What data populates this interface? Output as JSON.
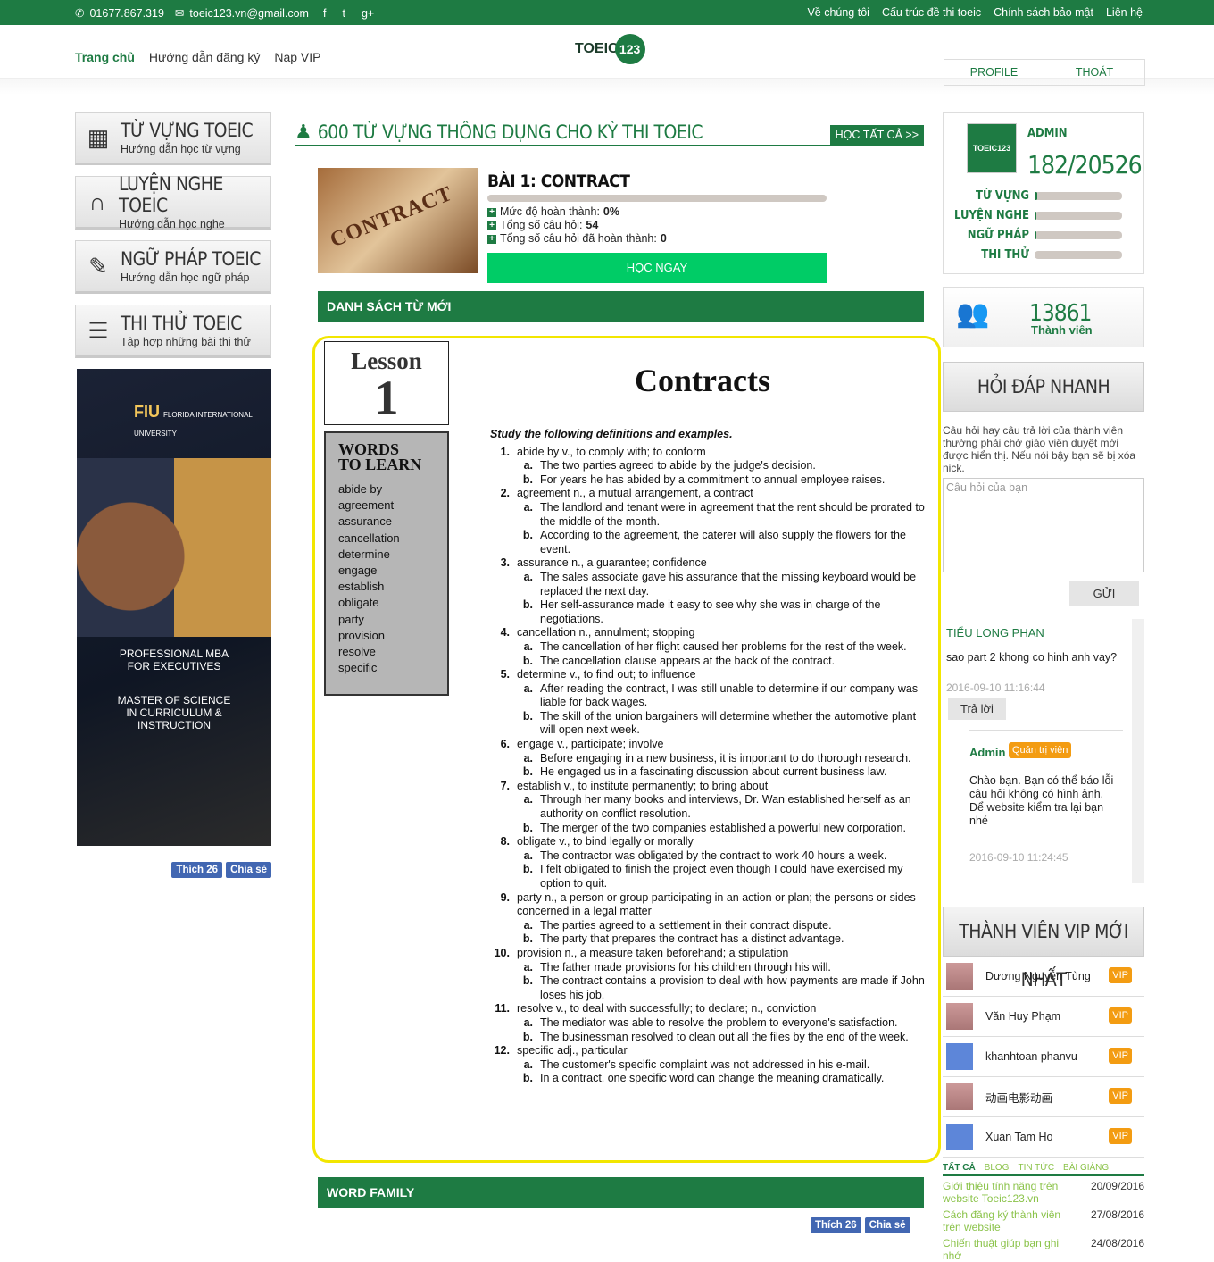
{
  "topbar": {
    "phone": "01677.867.319",
    "email": "toeic123.vn@gmail.com",
    "social": [
      "f",
      "t",
      "g+"
    ],
    "links": [
      "Về chúng tôi",
      "Cấu trúc đề thi toeic",
      "Chính sách bảo mật",
      "Liên hệ"
    ]
  },
  "nav": {
    "menu": [
      "Trang chủ",
      "Hướng dẫn đăng ký",
      "Nạp VIP"
    ],
    "logo_text": "TOEIC",
    "logo_num": "123",
    "profile": "PROFILE",
    "logout": "THOÁT"
  },
  "left": {
    "buttons": [
      {
        "icon": "abc-blocks-icon",
        "glyph": "▦",
        "title": "TỪ VỰNG TOEIC",
        "sub": "Hướng dẫn học từ vựng"
      },
      {
        "icon": "headphones-icon",
        "glyph": "🎧",
        "title": "LUYỆN NGHE TOEIC",
        "sub": "Hướng dẫn học nghe"
      },
      {
        "icon": "pencil-icon",
        "glyph": "✎",
        "title": "NGỮ PHÁP TOEIC",
        "sub": "Hướng dẫn học ngữ pháp"
      },
      {
        "icon": "test-document-icon",
        "glyph": "☰",
        "title": "THI THỬ TOEIC",
        "sub": "Tập hợp những bài thi thử"
      }
    ],
    "ad": {
      "logo": "FIU",
      "logo_sub": "FLORIDA INTERNATIONAL UNIVERSITY",
      "lines": [
        "PROFESSIONAL MBA",
        "FOR EXECUTIVES",
        "MASTER OF SCIENCE",
        "IN CURRICULUM &",
        "INSTRUCTION"
      ]
    },
    "like": "Thích 26",
    "share": "Chia sẻ"
  },
  "center": {
    "title": "600 TỪ VỰNG THÔNG DỤNG CHO KỲ THI TOEIC",
    "learn_all": "HỌC TẤT CẢ >>",
    "lesson": {
      "img_text": "CONTRACT",
      "name": "BÀI 1: CONTRACT",
      "progress": 0,
      "r1_label": "Mức độ hoàn thành:",
      "r1_val": "0%",
      "r2_label": "Tổng số câu hỏi:",
      "r2_val": "54",
      "r3_label": "Tổng số câu hỏi đã hoàn thành:",
      "r3_val": "0",
      "go": "HỌC NGAY"
    },
    "sec1": "DANH SÁCH TỪ MỚI",
    "sec2": "WORD FAMILY",
    "doc": {
      "lesson_label": "Lesson",
      "lesson_num": "1",
      "title": "Contracts",
      "wtl_title1": "WORDS",
      "wtl_title2": "TO LEARN",
      "words": [
        "abide by",
        "agreement",
        "assurance",
        "cancellation",
        "determine",
        "engage",
        "establish",
        "obligate",
        "party",
        "provision",
        "resolve",
        "specific"
      ],
      "intro": "Study the following definitions and examples.",
      "items": [
        {
          "n": "1.",
          "head": "abide by v., to comply with; to conform",
          "a": "The two parties agreed to abide by the judge's decision.",
          "b": "For years he has abided by a commitment to annual employee raises."
        },
        {
          "n": "2.",
          "head": "agreement n., a mutual arrangement, a contract",
          "a": "The landlord and tenant were in agreement that the rent should be prorated to the middle of the month.",
          "b": "According to the agreement, the caterer will also supply the flowers for the event."
        },
        {
          "n": "3.",
          "head": "assurance n., a guarantee; confidence",
          "a": "The sales associate gave his assurance that the missing keyboard would be replaced the next day.",
          "b": "Her self-assurance made it easy to see why she was in charge of the negotiations."
        },
        {
          "n": "4.",
          "head": "cancellation n., annulment; stopping",
          "a": "The cancellation of her flight caused her problems for the rest of the week.",
          "b": "The cancellation clause appears at the back of the contract."
        },
        {
          "n": "5.",
          "head": "determine v., to find out; to influence",
          "a": "After reading the contract, I was still unable to determine if our company was liable for back wages.",
          "b": "The skill of the union bargainers will determine whether the automotive plant will open next week."
        },
        {
          "n": "6.",
          "head": "engage v., participate; involve",
          "a": "Before engaging in a new business, it is important to do thorough research.",
          "b": "He engaged us in a fascinating discussion about current business law."
        },
        {
          "n": "7.",
          "head": "establish v., to institute permanently; to bring about",
          "a": "Through her many books and interviews, Dr. Wan established herself as an authority on conflict resolution.",
          "b": "The merger of the two companies established a powerful new corporation."
        },
        {
          "n": "8.",
          "head": "obligate v., to bind legally or morally",
          "a": "The contractor was obligated by the contract to work 40 hours a week.",
          "b": "I felt obligated to finish the project even though I could have exercised my option to quit."
        },
        {
          "n": "9.",
          "head": "party n., a person or group participating in an action or plan; the persons or sides concerned in a legal matter",
          "a": "The parties agreed to a settlement in their contract dispute.",
          "b": "The party that prepares the contract has a distinct advantage."
        },
        {
          "n": "10.",
          "head": "provision n., a measure taken beforehand; a stipulation",
          "a": "The father made provisions for his children through his will.",
          "b": "The contract contains a provision to deal with how payments are made if John loses his job."
        },
        {
          "n": "11.",
          "head": "resolve v., to deal with successfully; to declare; n., conviction",
          "a": "The mediator was able to resolve the problem to everyone's satisfaction.",
          "b": "The businessman resolved to clean out all the files by the end of the week."
        },
        {
          "n": "12.",
          "head": "specific adj., particular",
          "a": "The customer's specific complaint was not addressed in his e-mail.",
          "b": "In a contract, one specific word can change the meaning dramatically."
        }
      ]
    },
    "like": "Thích 26",
    "share": "Chia sẻ"
  },
  "right": {
    "user": {
      "avatar": "TOEIC123",
      "name": "ADMIN",
      "score": "182/20526",
      "stats": [
        {
          "label": "TỪ VỰNG",
          "fill": 0.03
        },
        {
          "label": "LUYỆN NGHE",
          "fill": 0.01
        },
        {
          "label": "NGỮ PHÁP",
          "fill": 0.01
        },
        {
          "label": "THI THỬ",
          "fill": 0
        }
      ]
    },
    "members": {
      "count": "13861",
      "label": "Thành viên"
    },
    "qa_title": "HỎI ĐÁP NHANH",
    "qa_note": "Câu hỏi hay câu trả lời của thành viên thường phải chờ giáo viên duyệt mới được hiển thị. Nếu nói bậy bạn sẽ bị xóa nick.",
    "qa_placeholder": "Câu hỏi của bạn",
    "send": "GỬI",
    "q": {
      "user": "TIỂU LONG PHAN",
      "text": "sao part 2 khong co hinh anh vay?",
      "date": "2016-09-10 11:16:44",
      "reply": "Trả lời"
    },
    "a": {
      "user": "Admin",
      "badge": "Quản trị viên",
      "text": "Chào bạn. Bạn có thể báo lỗi câu hỏi không có hình ảnh. Để website kiểm tra lại bạn nhé",
      "date": "2016-09-10 11:24:45"
    },
    "vip_title": "THÀNH VIÊN VIP MỚI NHẤT",
    "vips": [
      {
        "name": "Dương Nguyễn Tùng",
        "badge": "VIP"
      },
      {
        "name": "Văn Huy Phạm",
        "badge": "VIP"
      },
      {
        "name": "khanhtoan phanvu",
        "badge": "VIP"
      },
      {
        "name": "动画电影动画",
        "badge": "VIP"
      },
      {
        "name": "Xuan Tam Ho",
        "badge": "VIP"
      }
    ],
    "news_tabs": [
      "TẤT CẢ",
      "BLOG",
      "TIN TỨC",
      "BÀI GIẢNG"
    ],
    "news": [
      {
        "title": "Giới thiệu tính năng trên website Toeic123.vn",
        "date": "20/09/2016"
      },
      {
        "title": "Cách đăng ký thành viên trên website",
        "date": "27/08/2016"
      },
      {
        "title": "Chiến thuật giúp bạn ghi nhớ",
        "date": "24/08/2016"
      }
    ]
  }
}
